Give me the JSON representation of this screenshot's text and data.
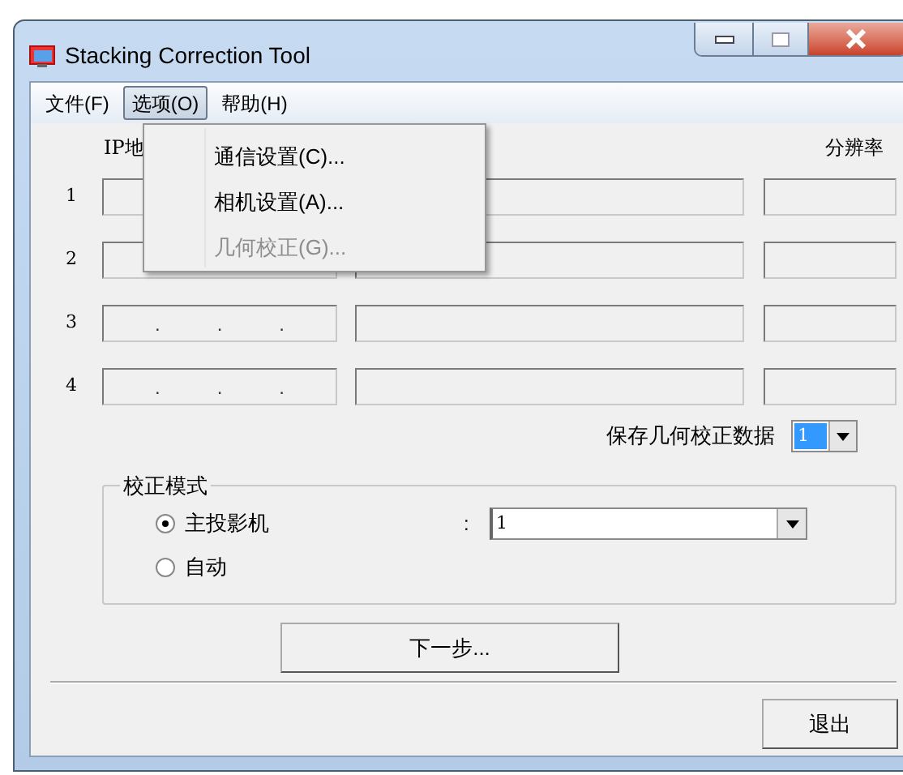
{
  "window": {
    "title": "Stacking Correction Tool"
  },
  "menu_bar": [
    {
      "label": "文件(F)",
      "selected": false
    },
    {
      "label": "选项(O)",
      "selected": true
    },
    {
      "label": "帮助(H)",
      "selected": false
    }
  ],
  "dropdown_menu": [
    {
      "label": "通信设置(C)...",
      "disabled": false
    },
    {
      "label": "相机设置(A)...",
      "disabled": false
    },
    {
      "label": "几何校正(G)...",
      "disabled": true
    }
  ],
  "columns": {
    "ip": "IP地",
    "resolution": "分辨率"
  },
  "rows": [
    {
      "number": "1"
    },
    {
      "number": "2"
    },
    {
      "number": "3",
      "ip_dots": [
        ".",
        ".",
        "."
      ]
    },
    {
      "number": "4",
      "ip_dots": [
        ".",
        ".",
        "."
      ]
    }
  ],
  "save_geometry": {
    "label": "保存几何校正数据",
    "value": "1"
  },
  "correction_mode": {
    "title": "校正模式",
    "options": [
      {
        "label": "主投影机",
        "selected": true
      },
      {
        "label": "自动",
        "selected": false
      }
    ],
    "colon": ":",
    "projector": "1"
  },
  "next_button": "下一步...",
  "exit_button": "退出"
}
